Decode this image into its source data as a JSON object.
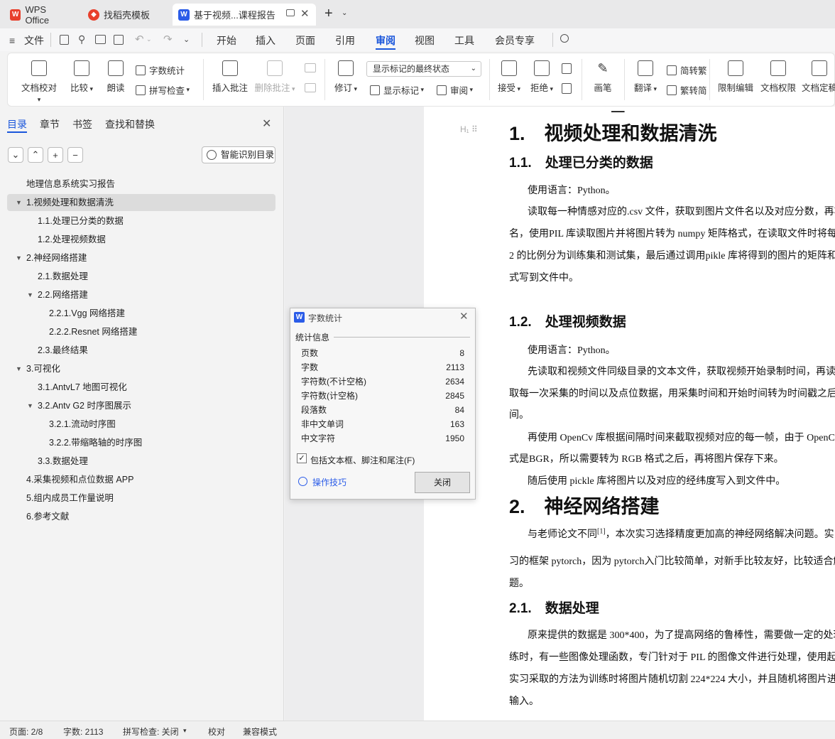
{
  "tabs": [
    {
      "label": "WPS Office",
      "icon": "wps-logo-icon"
    },
    {
      "label": "找稻壳模板",
      "icon": "docer-icon"
    },
    {
      "label": "基于视频...课程报告",
      "icon": "writer-doc-icon"
    }
  ],
  "menu": {
    "file": "文件",
    "items": [
      "开始",
      "插入",
      "页面",
      "引用",
      "审阅",
      "视图",
      "工具",
      "会员专享"
    ],
    "active": "审阅"
  },
  "ribbon": {
    "doc_proofread": "文档校对",
    "compare": "比较",
    "read_aloud": "朗读",
    "word_count": "字数统计",
    "spell_check": "拼写检查",
    "insert_comment": "插入批注",
    "delete_comment": "删除批注",
    "revise": "修订",
    "markup_select": "显示标记的最终状态",
    "show_markup": "显示标记",
    "review": "审阅",
    "accept": "接受",
    "reject": "拒绝",
    "pen": "画笔",
    "translate": "翻译",
    "to_traditional": "简转繁",
    "to_simplified": "繁转简",
    "restrict_edit": "限制编辑",
    "doc_permission": "文档权限",
    "doc_finalize": "文档定稿"
  },
  "sidebar": {
    "tabs": [
      "目录",
      "章节",
      "书签",
      "查找和替换"
    ],
    "smart_toc": "智能识别目录",
    "items": [
      {
        "label": "地理信息系统实习报告",
        "level": 0,
        "arrow": ""
      },
      {
        "label": "1.视频处理和数据清洗",
        "level": 0,
        "arrow": "▼",
        "selected": true
      },
      {
        "label": "1.1.处理已分类的数据",
        "level": 1,
        "arrow": ""
      },
      {
        "label": "1.2.处理视频数据",
        "level": 1,
        "arrow": ""
      },
      {
        "label": "2.神经网络搭建",
        "level": 0,
        "arrow": "▼"
      },
      {
        "label": "2.1.数据处理",
        "level": 1,
        "arrow": ""
      },
      {
        "label": "2.2.网络搭建",
        "level": 1,
        "arrow": "▼"
      },
      {
        "label": "2.2.1.Vgg 网络搭建",
        "level": 2,
        "arrow": ""
      },
      {
        "label": "2.2.2.Resnet 网络搭建",
        "level": 2,
        "arrow": ""
      },
      {
        "label": "2.3.最终结果",
        "level": 1,
        "arrow": ""
      },
      {
        "label": "3.可视化",
        "level": 0,
        "arrow": "▼"
      },
      {
        "label": "3.1.AntvL7 地图可视化",
        "level": 1,
        "arrow": ""
      },
      {
        "label": "3.2.Antv G2 时序图展示",
        "level": 1,
        "arrow": "▼"
      },
      {
        "label": "3.2.1.流动时序图",
        "level": 2,
        "arrow": ""
      },
      {
        "label": "3.2.2.带缩略轴的时序图",
        "level": 2,
        "arrow": ""
      },
      {
        "label": "3.3.数据处理",
        "level": 1,
        "arrow": ""
      },
      {
        "label": "4.采集视频和点位数据 APP",
        "level": 0,
        "arrow": ""
      },
      {
        "label": "5.组内成员工作量说明",
        "level": 0,
        "arrow": ""
      },
      {
        "label": "6.参考文献",
        "level": 0,
        "arrow": ""
      }
    ]
  },
  "document": {
    "h1_1": "1.　视频处理和数据清洗",
    "h2_11": "1.1.　处理已分类的数据",
    "p_lang1": "使用语言：Python。",
    "p_a1": "读取每一种情感对应的.csv 文件，获取到图片文件名以及对应分数，再将",
    "p_a2": "名，使用PIL 库读取图片并将图片转为 numpy 矩阵格式，在读取文件时将每一种",
    "p_a3": "2 的比例分为训练集和测试集，最后通过调用pikle 库将得到的图片的矩阵和分数",
    "p_a4": "式写到文件中。",
    "h2_12": "1.2.　处理视频数据",
    "p_lang2": "使用语言：Python。",
    "p_b1": "先读取和视频文件同级目录的文本文件，获取视频开始录制时间，再读取",
    "p_b2": "取每一次采集的时间以及点位数据，用采集时间和开始时间转为时间戳之后相减",
    "p_b3": "间。",
    "p_b4": "再使用 OpenCv 库根据间隔时间来截取视频对应的每一帧，由于 OpenCv",
    "p_b5": "式是BGR，所以需要转为 RGB 格式之后，再将图片保存下来。",
    "p_b6": "随后使用 pickle 库将图片以及对应的经纬度写入到文件中。",
    "h1_2": "2.　神经网络搭建",
    "p_c1a": "与老师论文不同",
    "p_c1sup": "[1]",
    "p_c1b": "，本次实习选择精度更加高的神经网络解决问题。实习",
    "p_c2": "习的框架 pytorch，因为 pytorch入门比较简单，对新手比较友好，比较适合解决",
    "p_c3": "题。",
    "h2_21": "2.1.　数据处理",
    "p_d1": "原来提供的数据是 300*400，为了提高网络的鲁棒性，需要做一定的处理",
    "p_d2": "练时，有一些图像处理函数，专门针对于 PIL 的图像文件进行处理，使用起来比",
    "p_d3": "实习采取的方法为训练时将图片随机切割 224*224 大小，并且随机将图片进行翻",
    "p_d4": "输入。"
  },
  "dialog": {
    "title": "字数统计",
    "section": "统计信息",
    "rows": [
      {
        "label": "页数",
        "value": "8"
      },
      {
        "label": "字数",
        "value": "2113"
      },
      {
        "label": "字符数(不计空格)",
        "value": "2634"
      },
      {
        "label": "字符数(计空格)",
        "value": "2845"
      },
      {
        "label": "段落数",
        "value": "84"
      },
      {
        "label": "非中文单词",
        "value": "163"
      },
      {
        "label": "中文字符",
        "value": "1950"
      }
    ],
    "checkbox_label": "包括文本框、脚注和尾注(F)",
    "checkbox_checked": true,
    "tips": "操作技巧",
    "close": "关闭"
  },
  "status": {
    "page": "页面: 2/8",
    "words": "字数: 2113",
    "spell": "拼写检查: 关闭",
    "proof": "校对",
    "compat": "兼容模式"
  },
  "colors": {
    "wps_red": "#e8402c",
    "accent_blue": "#2b5ce8",
    "active_tab": "#1a56db",
    "selected_toc": "#dcdcdc"
  }
}
